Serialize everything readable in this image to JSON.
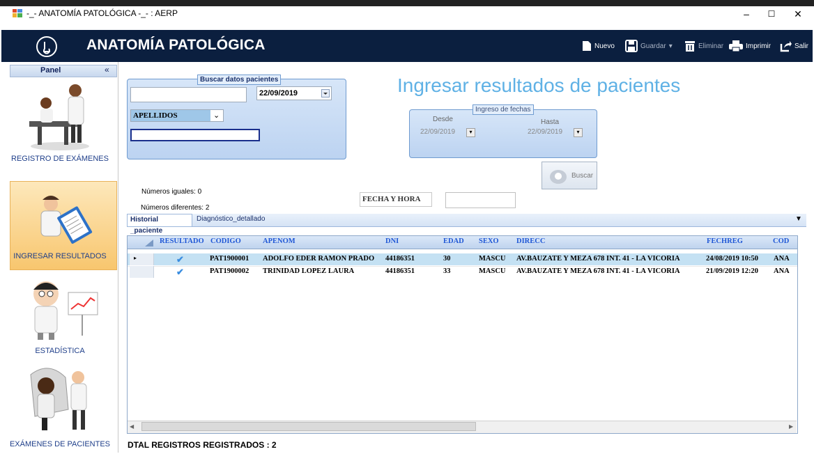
{
  "window": {
    "title": "-_- ANATOMÍA PATOLÓGICA -_- : AERP",
    "minimize": "–",
    "maximize": "☐",
    "close": "✕"
  },
  "header": {
    "title": "ANATOMÍA PATOLÓGICA",
    "toolbar": {
      "nuevo": "Nuevo",
      "guardar": "Guardar",
      "guardar_arrow": "▾",
      "eliminar": "Eliminar",
      "imprimir": "Imprimir",
      "salir": "Salir"
    }
  },
  "panel": {
    "title": "Panel",
    "collapse": "«",
    "items": [
      {
        "label": "REGISTRO DE EXÁMENES"
      },
      {
        "label": "INGRESAR RESULTADOS"
      },
      {
        "label": "ESTADÍSTICA"
      },
      {
        "label": "EXÁMENES DE PACIENTES"
      }
    ]
  },
  "search": {
    "group_caption": "Buscar datos pacientes",
    "date_value": "22/09/2019",
    "field_select": "APELLIDOS",
    "text_value": "",
    "name_value": ""
  },
  "main": {
    "title": "Ingresar resultados de pacientes"
  },
  "dates": {
    "group_caption": "Ingreso de fechas",
    "desde_label": "Desde",
    "desde_value": "22/09/2019",
    "hasta_label": "Hasta",
    "hasta_value": "22/09/2019"
  },
  "buscar_label": "Buscar",
  "counts": {
    "iguales": "Números iguales: 0",
    "diferentes": "Números diferentes: 2"
  },
  "fecha_hora_label": "FECHA Y HORA",
  "fecha_hora_value": "",
  "tabs": [
    {
      "label": "Historial _paciente"
    },
    {
      "label": "Diagnóstico_detallado"
    }
  ],
  "grid": {
    "columns": [
      "RESULTADO",
      "CODIGO",
      "APENOM",
      "DNI",
      "EDAD",
      "SEXO",
      "DIRECC",
      "FECHREG",
      "COD"
    ],
    "rows": [
      {
        "resultado": "✔",
        "codigo": "PAT1900001",
        "apenom": "ADOLFO EDER RAMON PRADO",
        "dni": "44186351",
        "edad": "30",
        "sexo": "MASCU",
        "direcc": "AV.BAUZATE Y MEZA 678 INT. 41 - LA VICORIA",
        "fechreg": "24/08/2019 10:50",
        "cod": "ANA"
      },
      {
        "resultado": "✔",
        "codigo": "PAT1900002",
        "apenom": "TRINIDAD LOPEZ LAURA",
        "dni": "44186351",
        "edad": "33",
        "sexo": "MASCU",
        "direcc": "AV.BAUZATE Y MEZA 678 INT. 41 - LA VICORIA",
        "fechreg": "21/09/2019 12:20",
        "cod": "ANA"
      }
    ]
  },
  "footer": {
    "total": "DTAL REGISTROS REGISTRADOS :  2"
  },
  "colors": {
    "header_bg": "#0b1f3f",
    "title_accent": "#5fb1e5",
    "selected_row": "#c4e1f3",
    "column_header_text": "#1f57d6"
  }
}
